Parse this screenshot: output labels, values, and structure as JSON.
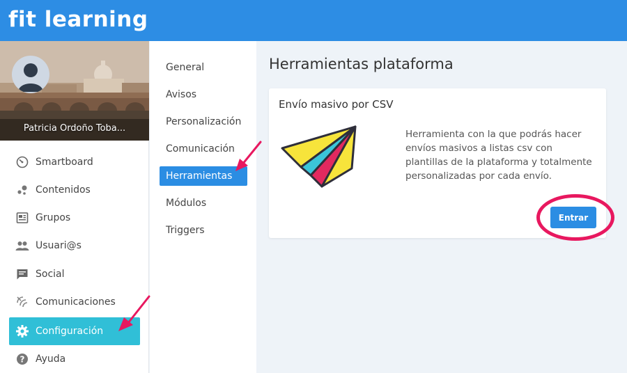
{
  "brand": {
    "logo_text": "fit learning",
    "primary_color": "#2d8de4"
  },
  "profile": {
    "name": "Patricia Ordoño Toba..."
  },
  "sidebar": {
    "items": [
      {
        "label": "Smartboard",
        "icon": "dashboard-gauge-icon"
      },
      {
        "label": "Contenidos",
        "icon": "bubbles-icon"
      },
      {
        "label": "Grupos",
        "icon": "group-card-icon"
      },
      {
        "label": "Usuari@s",
        "icon": "people-icon"
      },
      {
        "label": "Social",
        "icon": "chat-icon"
      },
      {
        "label": "Comunicaciones",
        "icon": "signal-icon"
      },
      {
        "label": "Configuración",
        "icon": "gear-icon",
        "active": true
      },
      {
        "label": "Ayuda",
        "icon": "help-icon"
      }
    ],
    "active_color": "#30bfd7"
  },
  "subnav": {
    "items": [
      {
        "label": "General"
      },
      {
        "label": "Avisos"
      },
      {
        "label": "Personalización"
      },
      {
        "label": "Comunicación"
      },
      {
        "label": "Herramientas",
        "active": true
      },
      {
        "label": "Módulos"
      },
      {
        "label": "Triggers"
      }
    ]
  },
  "main": {
    "title": "Herramientas plataforma",
    "card": {
      "title": "Envío masivo por CSV",
      "description": "Herramienta con la que podrás hacer envíos masivos a listas csv con plantillas de la plataforma y totalmente personalizadas por cada envío.",
      "button_label": "Entrar",
      "illustration": "paper-plane-icon"
    }
  },
  "annotations": {
    "color": "#e8185f"
  }
}
